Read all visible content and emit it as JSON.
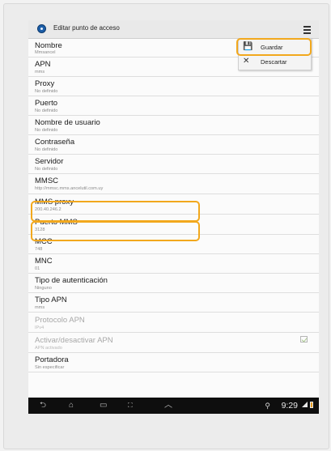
{
  "header": {
    "title": "Editar punto de acceso"
  },
  "menu": {
    "items": [
      {
        "icon": "floppy-disk-icon",
        "glyph": "💾",
        "label": "Guardar"
      },
      {
        "icon": "close-icon",
        "glyph": "✕",
        "label": "Descartar"
      }
    ]
  },
  "settings": [
    {
      "label": "Nombre",
      "value": "Mmsancel"
    },
    {
      "label": "APN",
      "value": "mms"
    },
    {
      "label": "Proxy",
      "value": "No definido"
    },
    {
      "label": "Puerto",
      "value": "No definido"
    },
    {
      "label": "Nombre de usuario",
      "value": "No definido"
    },
    {
      "label": "Contraseña",
      "value": "No definido"
    },
    {
      "label": "Servidor",
      "value": "No definido"
    },
    {
      "label": "MMSC",
      "value": "http://mmsc.mms.ancelutil.com.uy"
    },
    {
      "label": "MMS proxy",
      "value": "200.40.246.2"
    },
    {
      "label": "Puerto MMS",
      "value": "3128"
    },
    {
      "label": "MCC",
      "value": "748"
    },
    {
      "label": "MNC",
      "value": "01"
    },
    {
      "label": "Tipo de autenticación",
      "value": "Ninguno"
    },
    {
      "label": "Tipo APN",
      "value": "mms"
    },
    {
      "label": "Protocolo APN",
      "value": "IPv4",
      "disabled": true
    },
    {
      "label": "Activar/desactivar APN",
      "value": "APN activado",
      "disabled": true,
      "checked": true
    },
    {
      "label": "Portadora",
      "value": "Sin especificar"
    }
  ],
  "status_bar": {
    "time": "9:29"
  },
  "colors": {
    "highlight": "#f2a81d",
    "nav_bar": "#0e0e0e",
    "action_bar": "#e9e9e9"
  }
}
